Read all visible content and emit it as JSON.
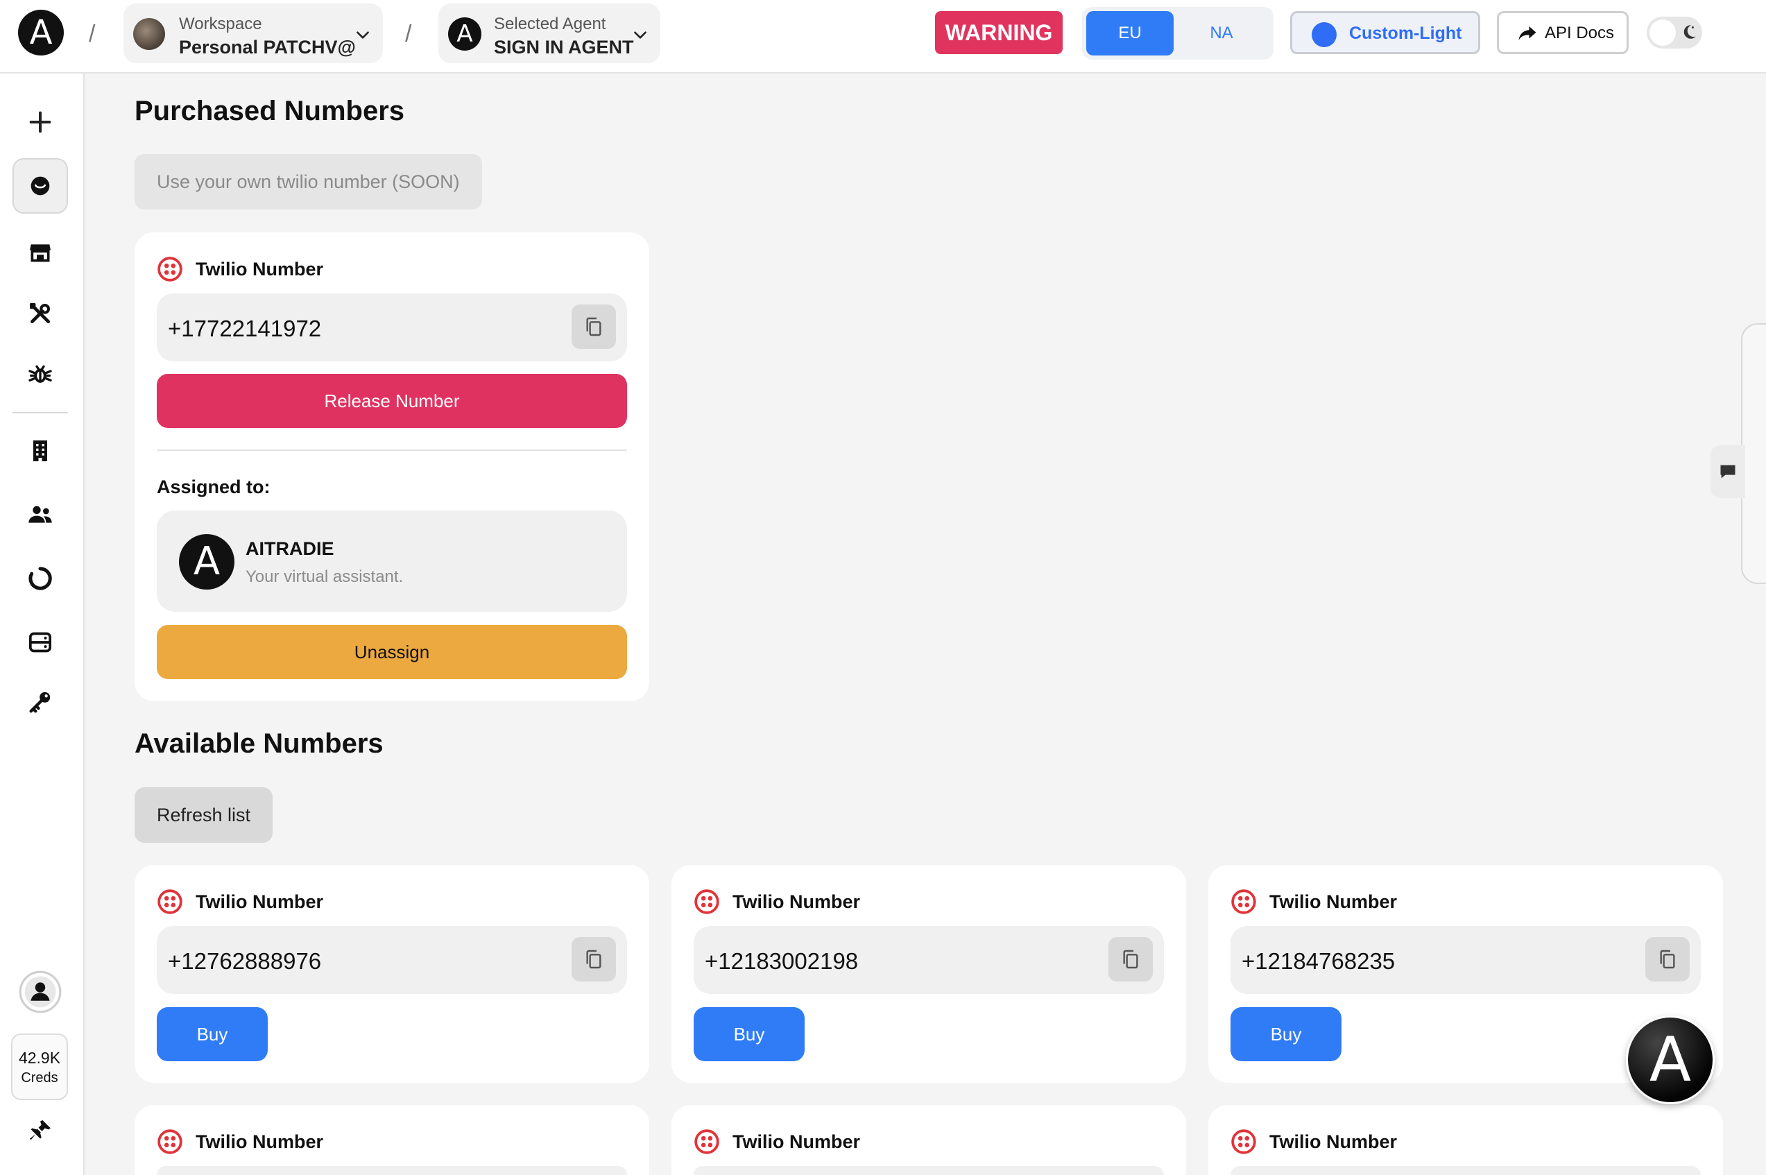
{
  "header": {
    "logo_letter": "A",
    "separator": "/",
    "workspace": {
      "label": "Workspace",
      "value": "Personal PATCHV@"
    },
    "agent": {
      "label": "Selected Agent",
      "value": "SIGN IN AGENT",
      "avatar_letter": "A"
    },
    "warning": "WARNING",
    "regions": [
      {
        "label": "EU",
        "active": true
      },
      {
        "label": "NA",
        "active": false
      }
    ],
    "theme": {
      "label": "Custom-Light",
      "color": "#2f6df6"
    },
    "api_docs": "API Docs",
    "dark_mode_toggle": false
  },
  "sidebar": {
    "items": [
      {
        "name": "add-icon",
        "active": false
      },
      {
        "name": "agent-face-icon",
        "active": true
      },
      {
        "name": "store-icon",
        "active": false
      },
      {
        "name": "tools-icon",
        "active": false
      },
      {
        "name": "bug-icon",
        "active": false
      },
      {
        "name": "building-icon",
        "active": false
      },
      {
        "name": "users-icon",
        "active": false
      },
      {
        "name": "loading-ring-icon",
        "active": false
      },
      {
        "name": "storage-icon",
        "active": false
      },
      {
        "name": "key-icon",
        "active": false
      },
      {
        "name": "profile-icon",
        "active": false
      },
      {
        "name": "pin-icon",
        "active": false
      }
    ],
    "creds": {
      "value": "42.9K",
      "label": "Creds"
    }
  },
  "purchased": {
    "title": "Purchased Numbers",
    "own_number_button": "Use your own twilio number (SOON)",
    "card": {
      "provider": "Twilio Number",
      "number": "+17722141972",
      "release_label": "Release Number",
      "assigned_label": "Assigned to:",
      "agent_name": "AITRADIE",
      "agent_description": "Your virtual assistant.",
      "agent_avatar_letter": "A",
      "unassign_label": "Unassign"
    }
  },
  "available": {
    "title": "Available Numbers",
    "refresh_label": "Refresh list",
    "buy_label": "Buy",
    "cards": [
      {
        "provider": "Twilio Number",
        "number": "+12762888976"
      },
      {
        "provider": "Twilio Number",
        "number": "+12183002198"
      },
      {
        "provider": "Twilio Number",
        "number": "+12184768235"
      },
      {
        "provider": "Twilio Number",
        "number": ""
      },
      {
        "provider": "Twilio Number",
        "number": ""
      },
      {
        "provider": "Twilio Number",
        "number": ""
      }
    ]
  },
  "colors": {
    "accent_blue": "#2f7cf6",
    "danger": "#df3261",
    "warning": "#e0345e",
    "unassign": "#eca940",
    "twilio_red": "#e0343a"
  }
}
